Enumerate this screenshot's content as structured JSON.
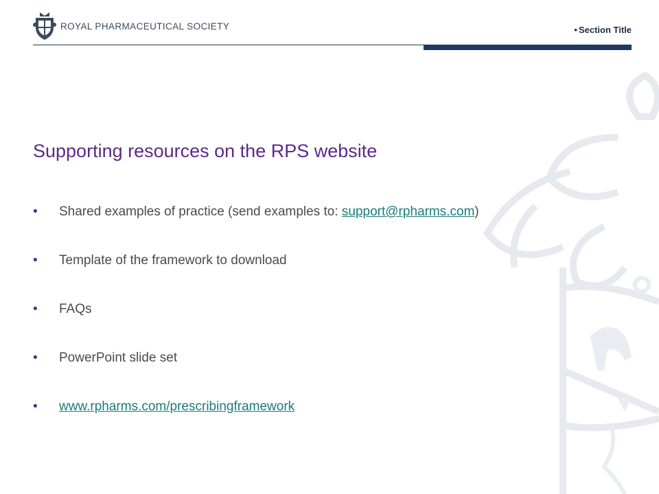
{
  "header": {
    "logo_text": "ROYAL PHARMACEUTICAL SOCIETY",
    "section_title": "Section Title",
    "rule_color": "#1f3a5f"
  },
  "slide": {
    "title": "Supporting resources on the RPS website",
    "title_color": "#5b2a86",
    "bullets": [
      {
        "text_before": "Shared examples of practice (send examples to: ",
        "link": "support@rpharms.com",
        "text_after": ")"
      },
      {
        "text": "Template of the framework to download"
      },
      {
        "text": "FAQs"
      },
      {
        "text": "PowerPoint slide set"
      },
      {
        "link": "www.rpharms.com/prescribingframework"
      }
    ],
    "bullet_glyph": "•",
    "link_color": "#1a7a7a"
  }
}
